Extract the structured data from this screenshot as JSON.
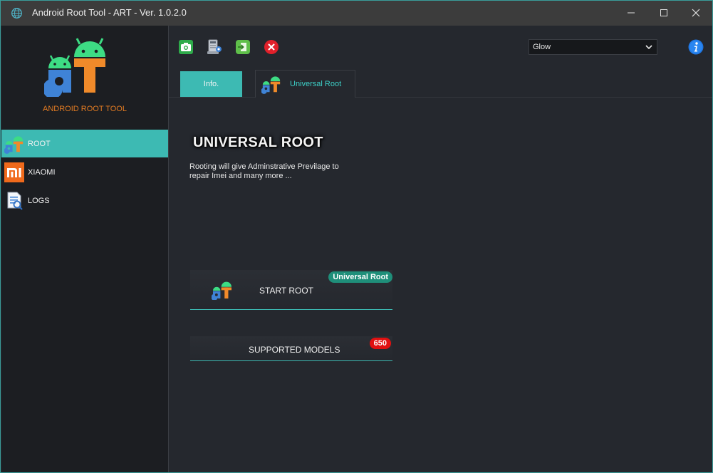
{
  "window": {
    "title": "Android Root Tool - ART - Ver. 1.0.2.0",
    "accent_color": "#3dbab3",
    "controls": [
      "minimize-icon",
      "maximize-icon",
      "close-icon"
    ]
  },
  "sidebar": {
    "logo_text": "ANDROID ROOT TOOL",
    "items": [
      {
        "label": "ROOT",
        "icon": "art-logo-icon",
        "active": true
      },
      {
        "label": "XIAOMI",
        "icon": "mi-logo-icon",
        "active": false
      },
      {
        "label": "LOGS",
        "icon": "log-document-icon",
        "active": false
      }
    ]
  },
  "toolbar": {
    "buttons": [
      "screenshot-camera-icon",
      "device-manager-icon",
      "exit-door-icon",
      "cancel-red-x-icon"
    ],
    "theme_select": {
      "value": "Glow"
    },
    "info_icon": "info-icon"
  },
  "tabs": [
    {
      "label": "Info.",
      "active": false
    },
    {
      "label": "Universal Root",
      "active": true
    }
  ],
  "content": {
    "heading": "UNIVERSAL ROOT",
    "description": "Rooting will give Adminstrative Previlage to repair Imei and many more ...",
    "start_root": {
      "label": "START ROOT",
      "badge": "Universal Root"
    },
    "supported_models": {
      "label": "SUPPORTED MODELS",
      "badge": "650"
    }
  }
}
